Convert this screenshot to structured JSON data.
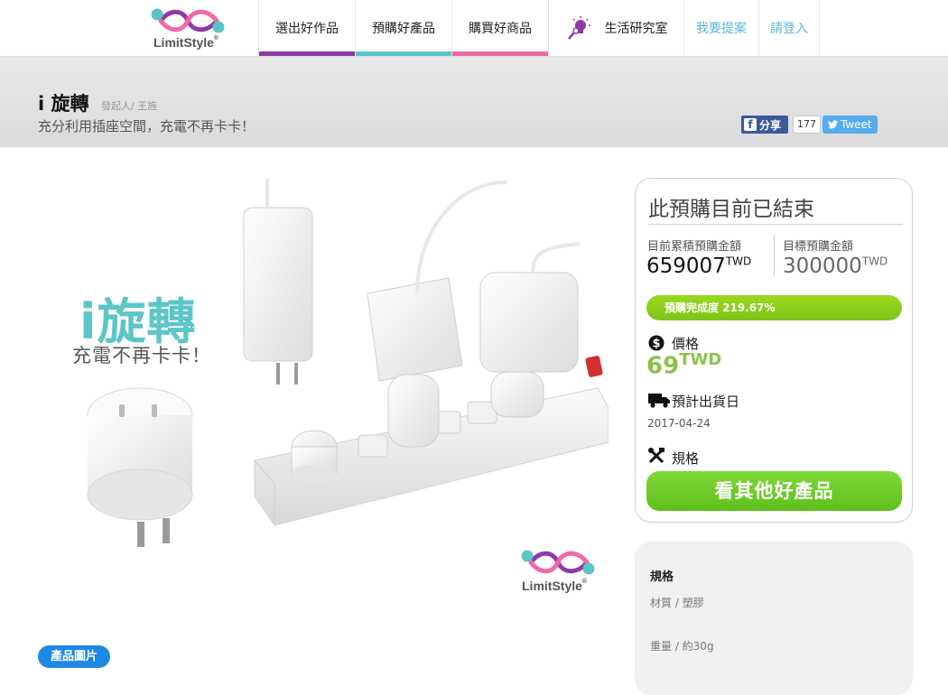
{
  "brand": {
    "name": "LimitStyle",
    "registered": "®"
  },
  "nav": {
    "items": [
      {
        "label": "選出好作品",
        "accent": "#8e3aa8"
      },
      {
        "label": "預購好產品",
        "accent": "#5bc4c6"
      },
      {
        "label": "購買好商品",
        "accent": "#ef6aa5"
      },
      {
        "label": "生活研究室",
        "icon": "lightbulb-icon"
      },
      {
        "label": "我要提案"
      },
      {
        "label": "請登入"
      }
    ]
  },
  "project": {
    "title": "i 旋轉",
    "founder": "發起人/ 王旌",
    "tagline": "充分利用插座空間，充電不再卡卡！"
  },
  "social": {
    "share_label": "分享",
    "share_count": "177",
    "tweet_label": "Tweet"
  },
  "hero": {
    "title": "i旋轉",
    "subtitle": "充電不再卡卡！",
    "photos_tag": "產品圖片"
  },
  "funding": {
    "status": "此預購目前已結束",
    "raised_label": "目前累積預購金額",
    "raised_amount": "659007",
    "raised_currency": "TWD",
    "goal_label": "目標預購金額",
    "goal_amount": "300000",
    "goal_currency": "TWD",
    "progress_text": "預購完成度 219.67%",
    "progress_fraction": 1.0,
    "price_label": "價格",
    "price_amount": "69",
    "price_currency": "TWD",
    "ship_label": "預計出貨日",
    "ship_date": "2017-04-24",
    "spec_label": "規格",
    "cta_label": "看其他好產品"
  },
  "specs": {
    "title": "規格",
    "lines": [
      "材質 / 塑膠",
      "重量 / 約30g"
    ]
  },
  "colors": {
    "accent_green": "#7fc41a",
    "accent_blue": "#1e88e5",
    "teal": "#5cc5c9",
    "facebook": "#3b5998",
    "twitter": "#55acee"
  }
}
